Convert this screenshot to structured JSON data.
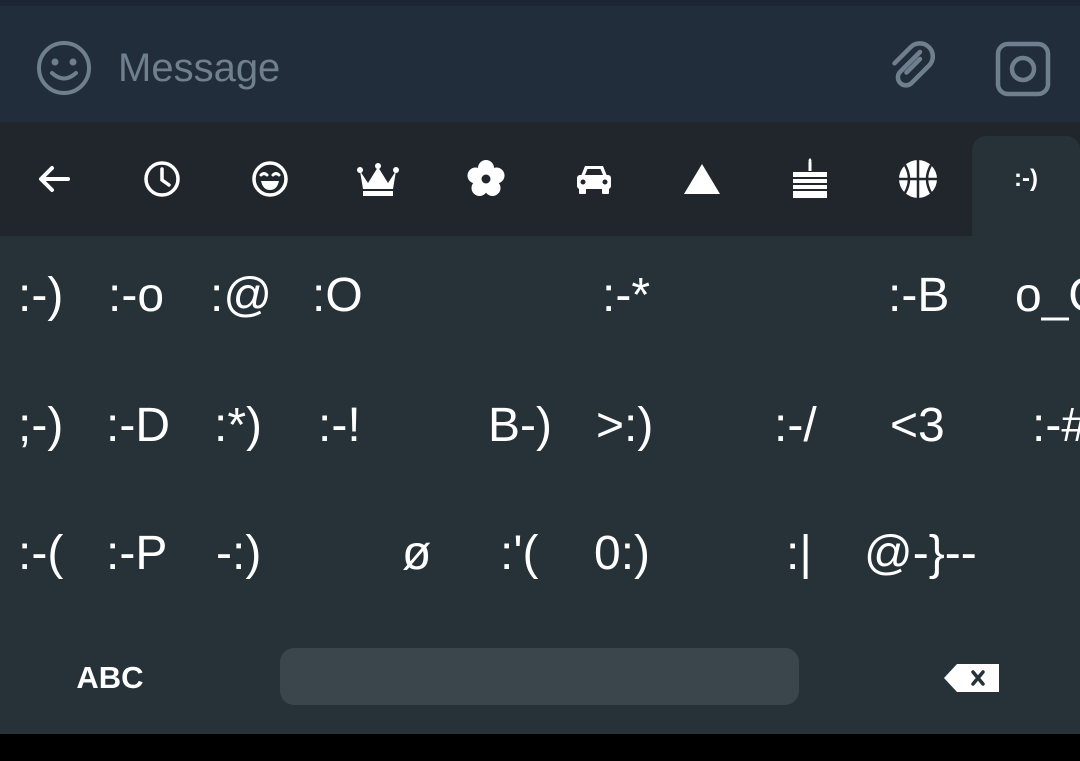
{
  "message_bar": {
    "placeholder": "Message",
    "emoji_icon": "smiley-icon",
    "attach_icon": "paperclip-icon",
    "camera_icon": "camera-icon"
  },
  "tabs": [
    {
      "icon": "back-arrow-icon"
    },
    {
      "icon": "clock-icon"
    },
    {
      "icon": "smiley-icon"
    },
    {
      "icon": "crown-icon"
    },
    {
      "icon": "flower-icon"
    },
    {
      "icon": "car-icon"
    },
    {
      "icon": "triangle-icon"
    },
    {
      "icon": "cake-icon"
    },
    {
      "icon": "basketball-icon"
    },
    {
      "label": ":-)",
      "active": true
    }
  ],
  "emoticons": {
    "row1": [
      ":-)",
      ":-o",
      ":@",
      ":O",
      ":-*",
      ":-B",
      "o_O"
    ],
    "row2": [
      ";-)",
      ":-D",
      ":*)",
      ":-!",
      "B-)",
      ">:)",
      ":-/",
      "<3",
      ":-#"
    ],
    "row3": [
      ":-(",
      ":-P",
      "-:)",
      "ø",
      ":'(",
      "0:)",
      ":|",
      "@-}--"
    ]
  },
  "keyboard": {
    "abc_label": "ABC",
    "backspace_icon": "backspace-icon"
  },
  "colors": {
    "message_bar_bg": "#212d3b",
    "tabs_bg": "#20262c",
    "keyboard_bg": "#263238",
    "space_bar_bg": "#3a454c",
    "icon_gray": "#6f7f8e",
    "text_white": "#ffffff"
  }
}
